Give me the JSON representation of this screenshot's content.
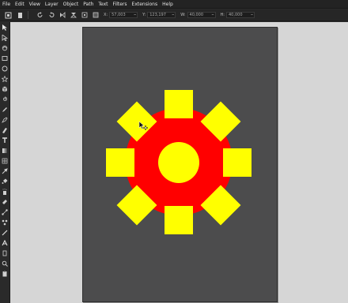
{
  "menu": [
    "File",
    "Edit",
    "View",
    "Layer",
    "Object",
    "Path",
    "Text",
    "Filters",
    "Extensions",
    "Help"
  ],
  "controls": {
    "x_label": "X:",
    "x_value": "57,003",
    "y_label": "Y:",
    "y_value": "123,197",
    "w_label": "W:",
    "w_value": "40,000",
    "h_label": "H:",
    "h_value": "40,000"
  },
  "colors": {
    "gear_body": "#ff0000",
    "gear_teeth": "#ffff00",
    "page": "#4c4c4d",
    "canvas": "#d6d6d6"
  },
  "tools": [
    "selector-tool-icon",
    "node-tool-icon",
    "tweak-tool-icon",
    "rectangle-tool-icon",
    "ellipse-tool-icon",
    "star-tool-icon",
    "3d-box-tool-icon",
    "spiral-tool-icon",
    "pencil-tool-icon",
    "pen-tool-icon",
    "calligraphy-tool-icon",
    "text-tool-icon",
    "gradient-tool-icon",
    "mesh-tool-icon",
    "dropper-tool-icon",
    "paint-bucket-tool-icon",
    "spray-tool-icon",
    "eraser-tool-icon",
    "connector-tool-icon",
    "lpe-tool-icon",
    "measure-tool-icon",
    "pages-tool-icon",
    "zoom-tool-icon",
    "page-tool-icon"
  ]
}
